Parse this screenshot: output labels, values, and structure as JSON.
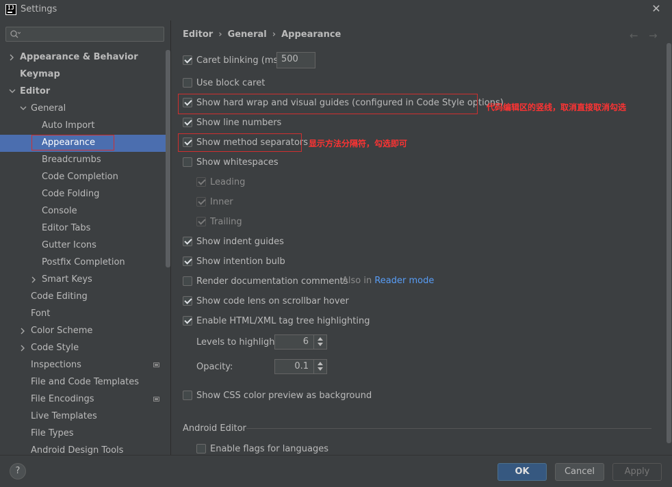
{
  "window": {
    "title": "Settings",
    "close_glyph": "✕"
  },
  "search": {
    "placeholder": ""
  },
  "tree": {
    "items": [
      {
        "label": "Appearance & Behavior"
      },
      {
        "label": "Keymap"
      },
      {
        "label": "Editor"
      },
      {
        "label": "General"
      },
      {
        "label": "Auto Import"
      },
      {
        "label": "Appearance"
      },
      {
        "label": "Breadcrumbs"
      },
      {
        "label": "Code Completion"
      },
      {
        "label": "Code Folding"
      },
      {
        "label": "Console"
      },
      {
        "label": "Editor Tabs"
      },
      {
        "label": "Gutter Icons"
      },
      {
        "label": "Postfix Completion"
      },
      {
        "label": "Smart Keys"
      },
      {
        "label": "Code Editing"
      },
      {
        "label": "Font"
      },
      {
        "label": "Color Scheme"
      },
      {
        "label": "Code Style"
      },
      {
        "label": "Inspections"
      },
      {
        "label": "File and Code Templates"
      },
      {
        "label": "File Encodings"
      },
      {
        "label": "Live Templates"
      },
      {
        "label": "File Types"
      },
      {
        "label": "Android Design Tools"
      }
    ],
    "selected": "Appearance"
  },
  "breadcrumb": {
    "items": [
      "Editor",
      "General",
      "Appearance"
    ],
    "separator": "›"
  },
  "nav": {
    "back": "←",
    "forward": "→"
  },
  "options": {
    "caret_blinking": {
      "label": "Caret blinking (ms):",
      "checked": true,
      "value": "500"
    },
    "block_caret": {
      "label": "Use block caret",
      "checked": false
    },
    "hard_wrap": {
      "label": "Show hard wrap and visual guides (configured in Code Style options)",
      "checked": true
    },
    "line_numbers": {
      "label": "Show line numbers",
      "checked": true
    },
    "method_separators": {
      "label": "Show method separators",
      "checked": true
    },
    "whitespaces": {
      "label": "Show whitespaces",
      "checked": false
    },
    "leading": {
      "label": "Leading",
      "checked": true
    },
    "inner": {
      "label": "Inner",
      "checked": true
    },
    "trailing": {
      "label": "Trailing",
      "checked": true
    },
    "indent_guides": {
      "label": "Show indent guides",
      "checked": true
    },
    "intention_bulb": {
      "label": "Show intention bulb",
      "checked": true
    },
    "render_docs": {
      "label": "Render documentation comments",
      "checked": false,
      "hint": "Also in",
      "link": "Reader mode"
    },
    "code_lens": {
      "label": "Show code lens on scrollbar hover",
      "checked": true
    },
    "tag_tree": {
      "label": "Enable HTML/XML tag tree highlighting",
      "checked": true
    },
    "levels": {
      "label": "Levels to highlight:",
      "value": "6"
    },
    "opacity": {
      "label": "Opacity:",
      "value": "0.1"
    },
    "css_color": {
      "label": "Show CSS color preview as background",
      "checked": false
    }
  },
  "android": {
    "section": "Android Editor",
    "flags": {
      "label": "Enable flags for languages",
      "checked": false
    }
  },
  "annotations": {
    "hard_wrap_note": "代码编辑区的竖线，取消直接取消勾选",
    "separator_note": "显示方法分隔符，勾选即可"
  },
  "buttons": {
    "help": "?",
    "ok": "OK",
    "cancel": "Cancel",
    "apply": "Apply"
  },
  "colors": {
    "selection": "#4b6eaf",
    "annotation": "#ff3333",
    "link": "#589df6",
    "ok_button": "#365880"
  }
}
